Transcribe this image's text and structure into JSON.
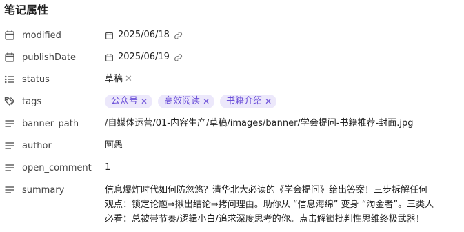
{
  "heading": "笔记属性",
  "properties": {
    "modified": {
      "key": "modified",
      "value": "2025/06/18"
    },
    "publishDate": {
      "key": "publishDate",
      "value": "2025/06/19"
    },
    "status": {
      "key": "status",
      "value": "草稿"
    },
    "tags": {
      "key": "tags",
      "items": [
        "公众号",
        "高效阅读",
        "书籍介绍"
      ]
    },
    "banner_path": {
      "key": "banner_path",
      "value": "/自媒体运营/01-内容生产/草稿/images/banner/学会提问-书籍推荐-封面.jpg"
    },
    "author": {
      "key": "author",
      "value": "阿愚"
    },
    "open_comment": {
      "key": "open_comment",
      "value": "1"
    },
    "summary": {
      "key": "summary",
      "lines": [
        "信息爆炸时代如何防忽悠？清华北大必读的《学会提问》给出答案！三步拆解任何",
        "观点：锁定论题⇒揪出结论⇒拷问理由。助你从 “信息海绵” 变身 “淘金者”。三类人",
        "必看：总被带节奏/逻辑小白/追求深度思考的你。点击解锁批判性思维终极武器！"
      ]
    }
  },
  "icons": {
    "date": "calendar-icon",
    "list": "list-icon",
    "tags": "tags-icon",
    "text": "text-lines-icon",
    "link": "link-icon",
    "remove": "close-icon"
  },
  "colors": {
    "tag_bg": "#ece8fb",
    "tag_text": "#6b4fd8"
  }
}
